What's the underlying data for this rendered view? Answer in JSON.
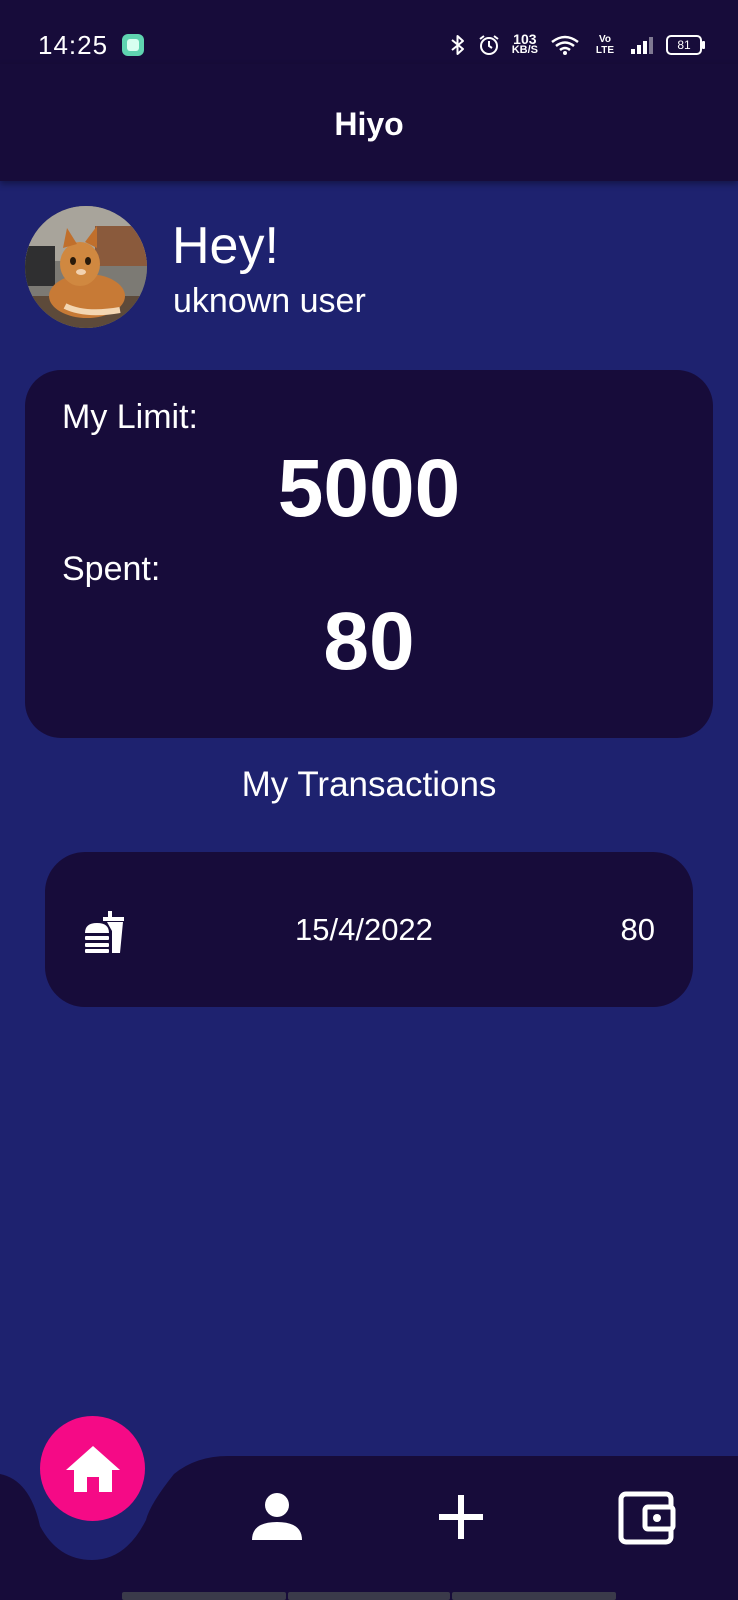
{
  "status_bar": {
    "time": "14:25",
    "net_speed_value": "103",
    "net_speed_unit": "KB/S",
    "volte": "Vo LTE",
    "battery": "81",
    "icons": [
      "app-notification-icon",
      "bluetooth-icon",
      "alarm-icon",
      "wifi-icon",
      "signal-icon",
      "battery-icon"
    ]
  },
  "app_bar": {
    "title": "Hiyo"
  },
  "profile": {
    "greeting": "Hey!",
    "username": "uknown user",
    "avatar": "cat-photo"
  },
  "limit_card": {
    "limit_label": "My Limit:",
    "limit_value": "5000",
    "spent_label": "Spent:",
    "spent_value": "80"
  },
  "transactions": {
    "heading": "My Transactions",
    "items": [
      {
        "icon": "fastfood-icon",
        "date": "15/4/2022",
        "amount": "80"
      }
    ]
  },
  "bottom_nav": {
    "items": [
      {
        "icon": "home-icon",
        "active": true
      },
      {
        "icon": "person-icon",
        "active": false
      },
      {
        "icon": "plus-icon",
        "active": false
      },
      {
        "icon": "wallet-icon",
        "active": false
      }
    ]
  },
  "colors": {
    "background": "#1e226f",
    "surface": "#170c3a",
    "accent": "#f50a86",
    "text": "#ffffff"
  }
}
